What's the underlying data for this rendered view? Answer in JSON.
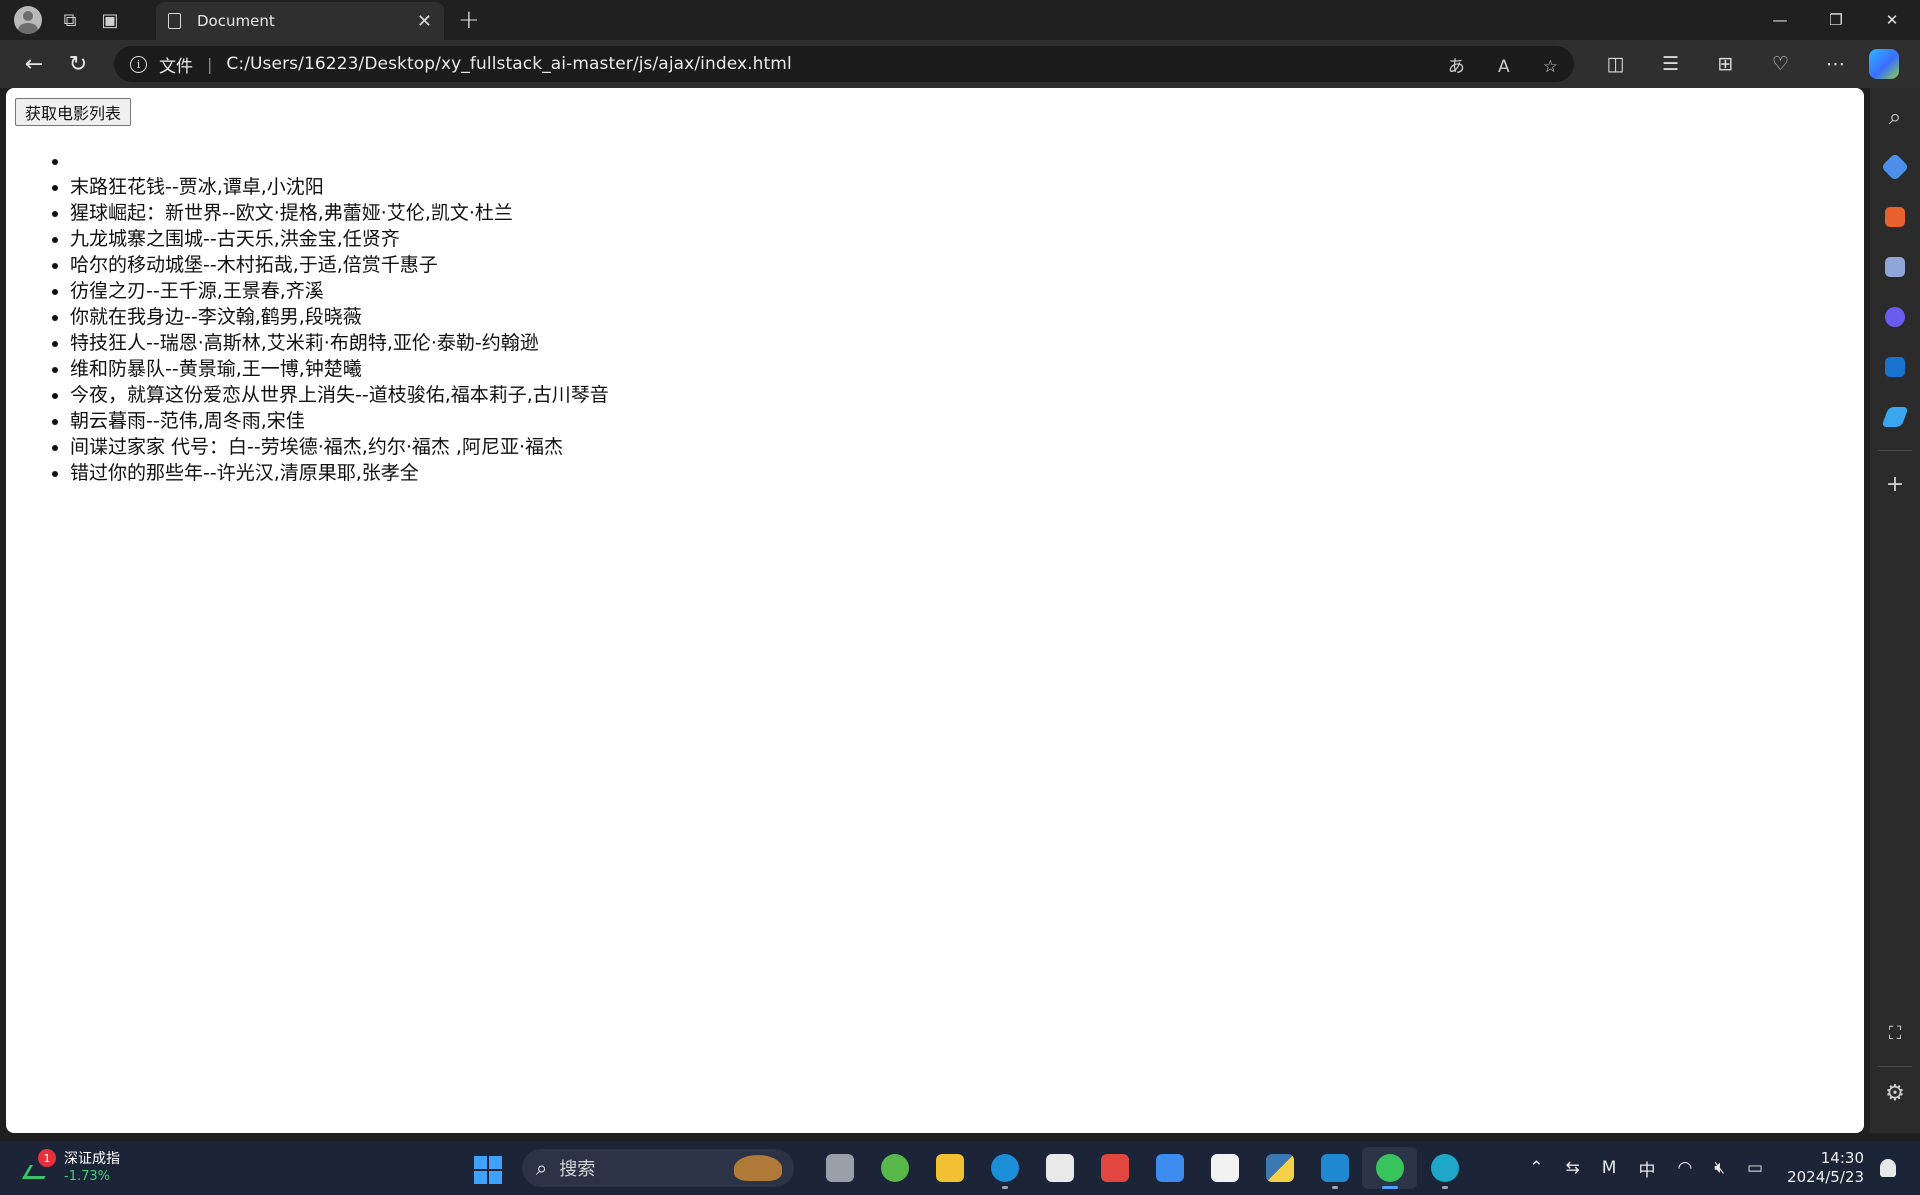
{
  "browser": {
    "tab": {
      "title": "Document",
      "close": "✕"
    },
    "new_tab": "+",
    "window": {
      "minimize": "—",
      "restore": "❐",
      "close": "✕"
    },
    "address": {
      "scheme_label": "文件",
      "separator": "|",
      "url": "C:/Users/16223/Desktop/xy_fullstack_ai-master/js/ajax/index.html"
    }
  },
  "page": {
    "button_label": "获取电影列表",
    "movies": [
      "",
      "末路狂花钱--贾冰,谭卓,小沈阳",
      "猩球崛起：新世界--欧文·提格,弗蕾娅·艾伦,凯文·杜兰",
      "九龙城寨之围城--古天乐,洪金宝,任贤齐",
      "哈尔的移动城堡--木村拓哉,于适,倍赏千惠子",
      "彷徨之刃--王千源,王景春,齐溪",
      "你就在我身边--李汶翰,鹤男,段晓薇",
      "特技狂人--瑞恩·高斯林,艾米莉·布朗特,亚伦·泰勒-约翰逊",
      "维和防暴队--黄景瑜,王一博,钟楚曦",
      "今夜，就算这份爱恋从世界上消失--道枝骏佑,福本莉子,古川琴音",
      "朝云暮雨--范伟,周冬雨,宋佳",
      "间谍过家家 代号：白--劳埃德·福杰,约尔·福杰 ,阿尼亚·福杰",
      "错过你的那些年--许光汉,清原果耶,张孝全"
    ]
  },
  "taskbar": {
    "stock": {
      "badge": "1",
      "name": "深证成指",
      "change": "-1.73%"
    },
    "search_placeholder": "搜索",
    "tray": {
      "ime": "中",
      "time": "14:30",
      "date": "2024/5/23"
    }
  },
  "colors": {
    "accent": "#4da3ff",
    "stock_down": "#3fd07a",
    "badge": "#e8303a"
  }
}
